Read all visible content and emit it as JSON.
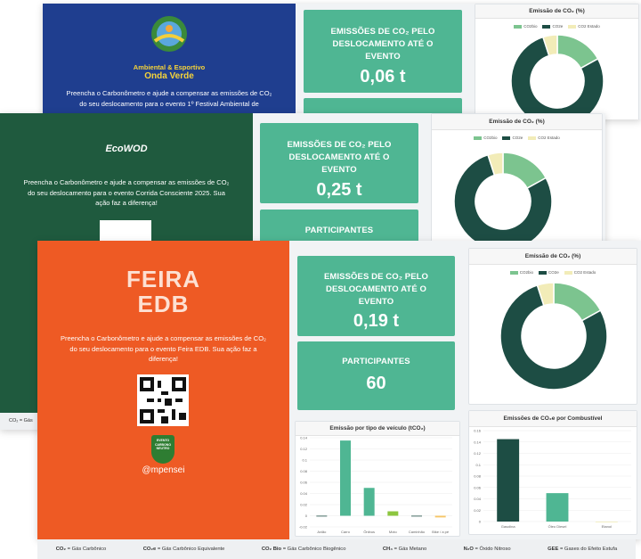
{
  "colors": {
    "teal": "#4fb693",
    "dark_teal": "#1d4d44",
    "light_green": "#7cc48f",
    "cream": "#f2ecb8"
  },
  "screen_a": {
    "logo_line1": "Ambiental & Esportivo",
    "logo_line2": "Onda Verde",
    "promo_text": "Preencha o Carbonômetro e ajude a compensar as emissões de CO₂ do seu deslocamento para o evento 1º Festival Ambiental de",
    "stat_label": "EMISSÕES DE CO₂ PELO DESLOCAMENTO ATÉ O EVENTO",
    "stat_value": "0,06 t",
    "chart_title": "Emissão de CO₂ (%)",
    "legend": [
      "CO2bio",
      "CO2e",
      "CO2 Estado"
    ]
  },
  "screen_b": {
    "logo": "EcoWOD",
    "promo_text": "Preencha o Carbonômetro e ajude a compensar as emissões de CO₂ do seu deslocamento para o evento Corrida Consciente 2025. Sua ação faz a diferença!",
    "stat_label": "EMISSÕES DE CO₂ PELO DESLOCAMENTO ATÉ O EVENTO",
    "stat_value": "0,25 t",
    "participants_label": "PARTICIPANTES",
    "chart_title": "Emissão de CO₂ (%)",
    "legend": [
      "CO2bio",
      "CO2e",
      "CO2 Estado"
    ],
    "side_label": "el",
    "footer_partial": "CO₂ = Gás"
  },
  "screen_c": {
    "logo_line1": "FEIRA",
    "logo_line2": "EDB",
    "promo_text": "Preencha o Carbonômetro e ajude a compensar as emissões de CO₂ do seu deslocamento para o evento Feira EDB. Sua ação faz a diferença!",
    "badge_line1": "EVENTO",
    "badge_line2": "CARBONO",
    "badge_line3": "NEUTRO",
    "brand": "@mpensei",
    "close": "×",
    "stat_label": "EMISSÕES DE CO₂ PELO DESLOCAMENTO ATÉ O EVENTO",
    "stat_value": "0,19 t",
    "participants_label": "PARTICIPANTES",
    "participants_value": "60",
    "donut_title": "Emissão de CO₂ (%)",
    "legend": [
      "CO2bio",
      "CO2e",
      "CO2 Estado"
    ],
    "bar1_title": "Emissão por tipo de veículo (tCO₂)",
    "bar2_title": "Emissões de CO₂e por Combustível"
  },
  "footer": [
    {
      "abbr": "CO₂",
      "desc": " = Gás Carbônico"
    },
    {
      "abbr": "CO₂e",
      "desc": " = Gás Carbônico Equivalente"
    },
    {
      "abbr": "CO₂ Bio",
      "desc": " = Gás Carbônico Biogênico"
    },
    {
      "abbr": "CH₄",
      "desc": " = Gás Metano"
    },
    {
      "abbr": "N₂O",
      "desc": " = Óxido Nitroso"
    },
    {
      "abbr": "GEE",
      "desc": " = Gases do Efeito Estufa"
    }
  ],
  "chart_data": [
    {
      "type": "pie",
      "title": "Emissão de CO₂ (%)",
      "series": [
        {
          "name": "CO2bio",
          "values": [
            17
          ]
        },
        {
          "name": "CO2e",
          "values": [
            78
          ]
        },
        {
          "name": "CO2 Estado",
          "values": [
            5
          ]
        }
      ],
      "categories": [
        "CO2bio",
        "CO2e",
        "CO2 Estado"
      ],
      "values": [
        17,
        78,
        5
      ]
    },
    {
      "type": "bar",
      "title": "Emissão por tipo de veículo (tCO₂)",
      "categories": [
        "Avião",
        "Carro",
        "Ônibus",
        "Moto",
        "Caminhão",
        "Bike / a pé"
      ],
      "values": [
        0,
        0.135,
        0.05,
        0.008,
        0,
        -0.003
      ],
      "ylim": [
        -0.02,
        0.14
      ],
      "yticks": [
        "0.14",
        "0.12",
        "0.1",
        "0.08",
        "0.06",
        "0.04",
        "0.02",
        "0",
        "-0.02"
      ]
    },
    {
      "type": "bar",
      "title": "Emissões de CO₂e por Combustível",
      "categories": [
        "Gasolina",
        "Óleo Diesel",
        "Etanol"
      ],
      "values": [
        0.145,
        0.05,
        0
      ],
      "ylim": [
        0,
        0.16
      ],
      "yticks": [
        "0.16",
        "0.14",
        "0.12",
        "0.1",
        "0.08",
        "0.06",
        "0.04",
        "0.02",
        "0"
      ]
    }
  ]
}
